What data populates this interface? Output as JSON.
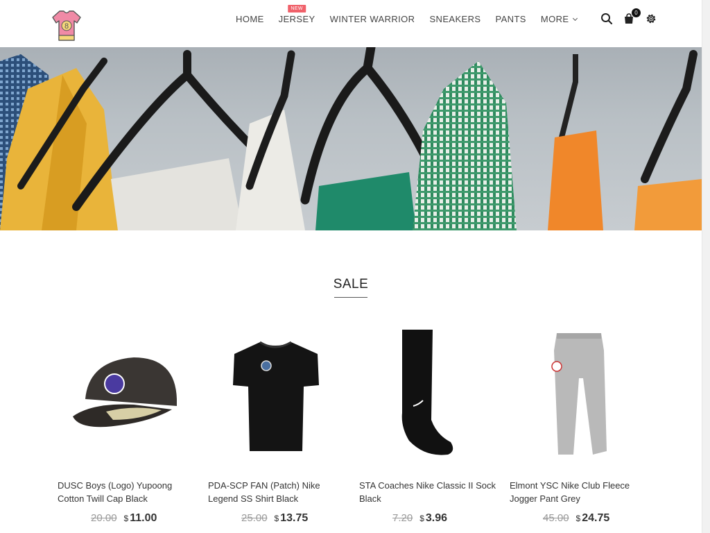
{
  "nav": {
    "items": [
      {
        "label": "HOME",
        "badge": ""
      },
      {
        "label": "JERSEY",
        "badge": "NEW"
      },
      {
        "label": "WINTER WARRIOR",
        "badge": ""
      },
      {
        "label": "SNEAKERS",
        "badge": ""
      },
      {
        "label": "PANTS",
        "badge": ""
      },
      {
        "label": "MORE",
        "badge": ""
      }
    ],
    "cart_count": "0"
  },
  "icons": {
    "logo": "jersey-logo-icon",
    "search": "search-icon",
    "cart": "shopping-bag-icon",
    "settings": "gear-icon",
    "more": "chevron-down-icon"
  },
  "colors": {
    "badge": "#f0616a",
    "logo_jersey": "#f08aa6",
    "logo_number": "#f6d77a"
  },
  "logo": {
    "number": "8"
  },
  "section": {
    "title": "SALE"
  },
  "products": [
    {
      "name": "DUSC Boys (Logo) Yupoong Cotton Twill Cap Black",
      "old_price": "20.00",
      "currency": "$",
      "price": "11.00"
    },
    {
      "name": "PDA-SCP FAN (Patch) Nike Legend SS Shirt Black",
      "old_price": "25.00",
      "currency": "$",
      "price": "13.75"
    },
    {
      "name": "STA Coaches Nike Classic II Sock Black",
      "old_price": "7.20",
      "currency": "$",
      "price": "3.96"
    },
    {
      "name": "Elmont YSC Nike Club Fleece Jogger Pant Grey",
      "old_price": "45.00",
      "currency": "$",
      "price": "24.75"
    }
  ]
}
